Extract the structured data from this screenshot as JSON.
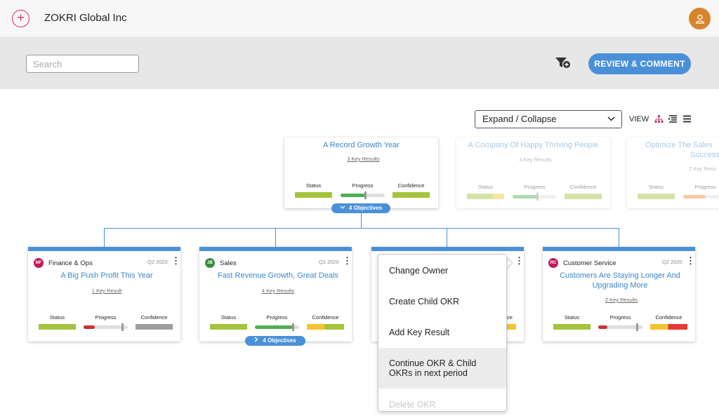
{
  "header": {
    "org_name": "ZOKRI Global Inc"
  },
  "toolbar": {
    "search_placeholder": "Search",
    "review_label": "REVIEW & COMMENT",
    "expand_select_value": "Expand / Collapse",
    "view_label": "VIEW"
  },
  "colors": {
    "accent": "#4a90d9",
    "brand": "#d6336c",
    "status_green": "#a3c43b",
    "progress_green": "#4caf50",
    "progress_red": "#d32f2f",
    "confidence_yellow": "#f4c430",
    "confidence_grey": "#9e9e9e",
    "confidence_red": "#e53935"
  },
  "top_objectives": [
    {
      "title": "A Record Growth Year",
      "key_results": "3 Key Results",
      "status": "Status",
      "progress": "Progress",
      "confidence": "Confidence",
      "children_pill": "4 Objectives",
      "progress_value": 0.55
    },
    {
      "title": "A Company Of Happy Thriving People",
      "key_results": "3 Key Results",
      "status": "Status",
      "progress": "Progress",
      "confidence": "Confidence",
      "progress_value": 0.55
    },
    {
      "title": "Optimize The Sales",
      "title_line2": "Success",
      "key_results": "2 Key Resu",
      "status": "Status",
      "progress": "Progress",
      "progress_value": 0.5
    }
  ],
  "objectives": [
    {
      "owner_initials": "MF",
      "owner_color": "#c2185b",
      "owner": "Finance & Ops",
      "period": "Q2 2020",
      "title": "A Big Push Profit This Year",
      "key_results": "1 Key Result",
      "status": "Status",
      "progress": "Progress",
      "confidence": "Confidence",
      "progress_value": 0.25
    },
    {
      "owner_initials": "JB",
      "owner_color": "#388e3c",
      "owner": "Sales",
      "period": "Q2 2020",
      "title": "Fast Revenue Growth, Great Deals",
      "key_results": "4 Key Results",
      "status": "Status",
      "progress": "Progress",
      "confidence": "Confidence",
      "children_pill": "4 Objectives",
      "progress_value": 0.85
    },
    {
      "owner_initials": "",
      "owner": "",
      "period": "",
      "title": "",
      "key_results": "",
      "status": "",
      "progress": "",
      "confidence": "ce"
    },
    {
      "owner_initials": "RC",
      "owner_color": "#c2185b",
      "owner": "Customer Service",
      "period": "Q2 2020",
      "title": "Customers Are Staying Longer And",
      "title_line2": "Upgrading More",
      "key_results": "2 Key Results",
      "status": "Status",
      "progress": "Progress",
      "confidence": "Confidence",
      "progress_value": 0.2
    }
  ],
  "context_menu": {
    "items": [
      {
        "label": "Change Owner"
      },
      {
        "label": "Create Child OKR"
      },
      {
        "label": "Add Key Result"
      },
      {
        "label": "Continue OKR & Child",
        "label_line2": "OKRs in next period"
      },
      {
        "label": "Delete OKR"
      }
    ]
  }
}
